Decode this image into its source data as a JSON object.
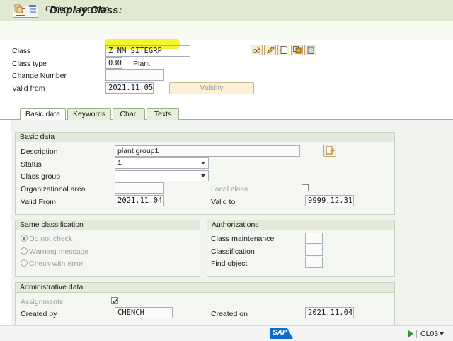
{
  "header": {
    "title": "Display Class:"
  },
  "toolbar": {
    "change_language": "Change Language"
  },
  "fields": {
    "class_label": "Class",
    "class_value": "Z_NM_SITEGRP",
    "class_type_label": "Class type",
    "class_type_value": "030",
    "class_type_text": "Plant",
    "change_number_label": "Change Number",
    "change_number_value": "",
    "valid_from_label": "Valid from",
    "valid_from_value": "2021.11.05",
    "validity_button": "Validity"
  },
  "tabs": [
    {
      "label": "Basic data",
      "active": true
    },
    {
      "label": "Keywords",
      "active": false
    },
    {
      "label": "Char.",
      "active": false
    },
    {
      "label": "Texts",
      "active": false
    }
  ],
  "basic_data": {
    "title": "Basic data",
    "description_label": "Description",
    "description_value": "plant group1",
    "status_label": "Status",
    "status_value": "1",
    "class_group_label": "Class group",
    "class_group_value": "",
    "org_area_label": "Organizational area",
    "org_area_value": "",
    "local_class_label": "Local class",
    "local_class_checked": false,
    "valid_from_label": "Valid From",
    "valid_from_value": "2021.11.04",
    "valid_to_label": "Valid to",
    "valid_to_value": "9999.12.31"
  },
  "same_classification": {
    "title": "Same classification",
    "options": [
      {
        "label": "Do not check",
        "selected": true
      },
      {
        "label": "Warning message",
        "selected": false
      },
      {
        "label": "Check with error",
        "selected": false
      }
    ]
  },
  "authorizations": {
    "title": "Authorizations",
    "class_maintenance_label": "Class maintenance",
    "class_maintenance_value": "",
    "classification_label": "Classification",
    "classification_value": "",
    "find_object_label": "Find object",
    "find_object_value": ""
  },
  "administrative": {
    "title": "Administrative data",
    "assignments_label": "Assignments",
    "assignments_checked": true,
    "created_by_label": "Created by",
    "created_by_value": "CHENCH",
    "created_on_label": "Created on",
    "created_on_value": "2021.11.04"
  },
  "status_bar": {
    "sap_logo": "SAP",
    "transaction_code": "CL03"
  },
  "colors": {
    "title_bar": "#dfe9cf",
    "highlight": "#f3f100",
    "tab_border": "#9bb385"
  }
}
